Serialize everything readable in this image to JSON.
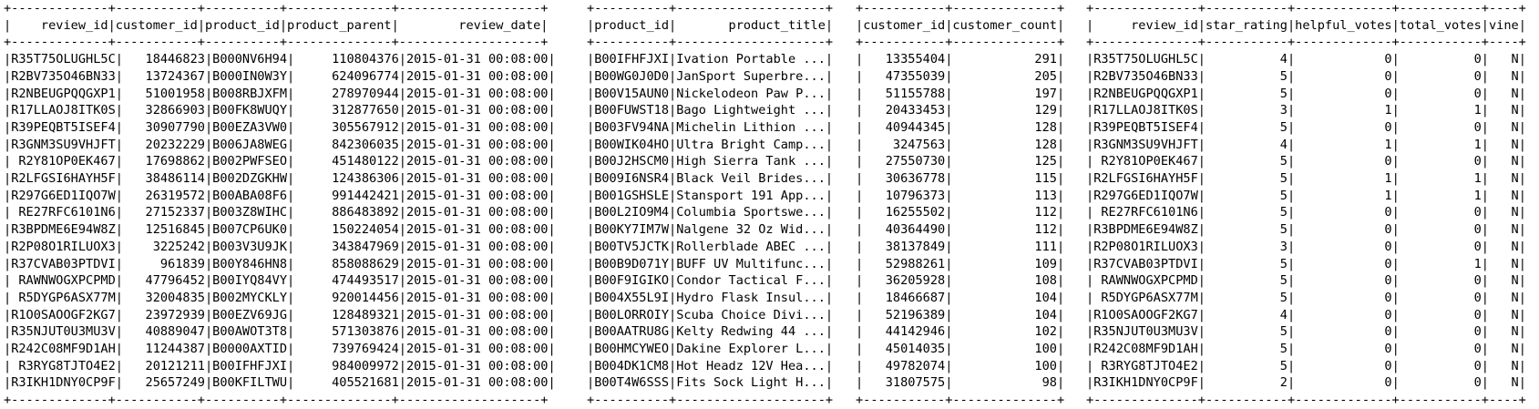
{
  "tables": [
    {
      "id": "reviews",
      "columns": [
        {
          "name": "review_id",
          "width": 13,
          "align": "right"
        },
        {
          "name": "customer_id",
          "width": 11,
          "align": "right"
        },
        {
          "name": "product_id",
          "width": 10,
          "align": "left"
        },
        {
          "name": "product_parent",
          "width": 14,
          "align": "right"
        },
        {
          "name": "review_date",
          "width": 19,
          "align": "right"
        }
      ],
      "rows": [
        [
          "R35T75OLUGHL5C",
          "18446823",
          "B000NV6H94",
          "110804376",
          "2015-01-31 00:08:00"
        ],
        [
          "R2BV735O46BN33",
          "13724367",
          "B000IN0W3Y",
          "624096774",
          "2015-01-31 00:08:00"
        ],
        [
          "R2NBEUGPQQGXP1",
          "51001958",
          "B008RBJXFM",
          "278970944",
          "2015-01-31 00:08:00"
        ],
        [
          "R17LLAOJ8ITK0S",
          "32866903",
          "B00FK8WUQY",
          "312877650",
          "2015-01-31 00:08:00"
        ],
        [
          "R39PEQBT5ISEF4",
          "30907790",
          "B00EZA3VW0",
          "305567912",
          "2015-01-31 00:08:00"
        ],
        [
          "R3GNM3SU9VHJFT",
          "20232229",
          "B006JA8WEG",
          "842306035",
          "2015-01-31 00:08:00"
        ],
        [
          " R2Y81OP0EK467",
          "17698862",
          "B002PWFSEO",
          "451480122",
          "2015-01-31 00:08:00"
        ],
        [
          "R2LFGSI6HAYH5F",
          "38486114",
          "B002DZGKHW",
          "124386306",
          "2015-01-31 00:08:00"
        ],
        [
          "R297G6ED1IQO7W",
          "26319572",
          "B00ABA08F6",
          "991442421",
          "2015-01-31 00:08:00"
        ],
        [
          " RE27RFC6101N6",
          "27152337",
          "B003Z8WIHC",
          "886483892",
          "2015-01-31 00:08:00"
        ],
        [
          "R3BPDME6E94W8Z",
          "12516845",
          "B007CP6UK0",
          "150224054",
          "2015-01-31 00:08:00"
        ],
        [
          "R2P08O1RILUOX3",
          "3225242",
          "B003V3U9JK",
          "343847969",
          "2015-01-31 00:08:00"
        ],
        [
          "R37CVAB03PTDVI",
          "961839",
          "B00Y846HN8",
          "858088629",
          "2015-01-31 00:08:00"
        ],
        [
          " RAWNWOGXPCPMD",
          "47796452",
          "B00IYQ84VY",
          "474493517",
          "2015-01-31 00:08:00"
        ],
        [
          " R5DYGP6ASX77M",
          "32004835",
          "B002MYCKLY",
          "920014456",
          "2015-01-31 00:08:00"
        ],
        [
          "R1O0SAOOGF2KG7",
          "23972939",
          "B00EZV69JG",
          "128489321",
          "2015-01-31 00:08:00"
        ],
        [
          "R35NJUT0U3MU3V",
          "40889047",
          "B00AWOT3T8",
          "571303876",
          "2015-01-31 00:08:00"
        ],
        [
          "R242C08MF9D1AH",
          "11244387",
          "B0000AXTID",
          "739769424",
          "2015-01-31 00:08:00"
        ],
        [
          " R3RYG8TJTO4E2",
          "20121211",
          "B00IFHFJXI",
          "984009972",
          "2015-01-31 00:08:00"
        ],
        [
          "R3IKH1DNY0CP9F",
          "25657249",
          "B00KFILTWU",
          "405521681",
          "2015-01-31 00:08:00"
        ]
      ]
    },
    {
      "id": "products",
      "columns": [
        {
          "name": "product_id",
          "width": 10,
          "align": "left"
        },
        {
          "name": "product_title",
          "width": 20,
          "align": "right"
        }
      ],
      "rows": [
        [
          "B00IFHFJXI",
          "Ivation Portable ..."
        ],
        [
          "B00WG0J0D0",
          "JanSport Superbre..."
        ],
        [
          "B00V15AUN0",
          "Nickelodeon Paw P..."
        ],
        [
          "B00FUWST18",
          "Bago Lightweight ..."
        ],
        [
          "B003FV94NA",
          "Michelin Lithion ..."
        ],
        [
          "B00WIK04HO",
          "Ultra Bright Camp..."
        ],
        [
          "B00J2HSCM0",
          "High Sierra Tank ..."
        ],
        [
          "B009I6NSR4",
          "Black Veil Brides..."
        ],
        [
          "B001GSHSLE",
          "Stansport 191 App..."
        ],
        [
          "B00L2IO9M4",
          "Columbia Sportswe..."
        ],
        [
          "B00KY7IM7W",
          "Nalgene 32 Oz Wid..."
        ],
        [
          "B00TV5JCTK",
          "Rollerblade ABEC ..."
        ],
        [
          "B00B9D071Y",
          "BUFF UV Multifunc..."
        ],
        [
          "B00F9IGIKO",
          "Condor Tactical F..."
        ],
        [
          "B004X55L9I",
          "Hydro Flask Insul..."
        ],
        [
          "B00LORROIY",
          "Scuba Choice Divi..."
        ],
        [
          "B00AATRU8G",
          "Kelty Redwing 44 ..."
        ],
        [
          "B00HMCYWEO",
          "Dakine Explorer L..."
        ],
        [
          "B004DK1CM8",
          "Hot Headz 12V Hea..."
        ],
        [
          "B00T4W6SSS",
          "Fits Sock Light H..."
        ]
      ]
    },
    {
      "id": "customers",
      "columns": [
        {
          "name": "customer_id",
          "width": 11,
          "align": "right"
        },
        {
          "name": "customer_count",
          "width": 14,
          "align": "right"
        }
      ],
      "rows": [
        [
          "13355404",
          "291"
        ],
        [
          "47355039",
          "205"
        ],
        [
          "51155788",
          "197"
        ],
        [
          "20433453",
          "129"
        ],
        [
          "40944345",
          "128"
        ],
        [
          "3247563",
          "128"
        ],
        [
          "27550730",
          "125"
        ],
        [
          "30636778",
          "115"
        ],
        [
          "10796373",
          "113"
        ],
        [
          "16255502",
          "112"
        ],
        [
          "40364490",
          "112"
        ],
        [
          "38137849",
          "111"
        ],
        [
          "52988261",
          "109"
        ],
        [
          "36205928",
          "108"
        ],
        [
          "18466687",
          "104"
        ],
        [
          "52196389",
          "104"
        ],
        [
          "44142946",
          "102"
        ],
        [
          "45014035",
          "100"
        ],
        [
          "49782074",
          "100"
        ],
        [
          "31807575",
          "98"
        ]
      ]
    },
    {
      "id": "ratings",
      "columns": [
        {
          "name": "review_id",
          "width": 14,
          "align": "right"
        },
        {
          "name": "star_rating",
          "width": 11,
          "align": "right"
        },
        {
          "name": "helpful_votes",
          "width": 13,
          "align": "right"
        },
        {
          "name": "total_votes",
          "width": 11,
          "align": "right"
        },
        {
          "name": "vine",
          "width": 4,
          "align": "right"
        }
      ],
      "rows": [
        [
          "R35T75OLUGHL5C",
          "4",
          "0",
          "0",
          "N"
        ],
        [
          "R2BV735O46BN33",
          "5",
          "0",
          "0",
          "N"
        ],
        [
          "R2NBEUGPQQGXP1",
          "5",
          "0",
          "0",
          "N"
        ],
        [
          "R17LLAOJ8ITK0S",
          "3",
          "1",
          "1",
          "N"
        ],
        [
          "R39PEQBT5ISEF4",
          "5",
          "0",
          "0",
          "N"
        ],
        [
          "R3GNM3SU9VHJFT",
          "4",
          "1",
          "1",
          "N"
        ],
        [
          " R2Y81OP0EK467",
          "5",
          "0",
          "0",
          "N"
        ],
        [
          "R2LFGSI6HAYH5F",
          "5",
          "1",
          "1",
          "N"
        ],
        [
          "R297G6ED1IQO7W",
          "5",
          "1",
          "1",
          "N"
        ],
        [
          " RE27RFC6101N6",
          "5",
          "0",
          "0",
          "N"
        ],
        [
          "R3BPDME6E94W8Z",
          "5",
          "0",
          "0",
          "N"
        ],
        [
          "R2P08O1RILUOX3",
          "3",
          "0",
          "0",
          "N"
        ],
        [
          "R37CVAB03PTDVI",
          "5",
          "0",
          "1",
          "N"
        ],
        [
          " RAWNWOGXPCPMD",
          "5",
          "0",
          "0",
          "N"
        ],
        [
          " R5DYGP6ASX77M",
          "5",
          "0",
          "0",
          "N"
        ],
        [
          "R1O0SAOOGF2KG7",
          "4",
          "0",
          "0",
          "N"
        ],
        [
          "R35NJUT0U3MU3V",
          "5",
          "0",
          "0",
          "N"
        ],
        [
          "R242C08MF9D1AH",
          "5",
          "0",
          "0",
          "N"
        ],
        [
          " R3RYG8TJTO4E2",
          "5",
          "0",
          "0",
          "N"
        ],
        [
          "R3IKH1DNY0CP9F",
          "2",
          "0",
          "0",
          "N"
        ]
      ]
    }
  ]
}
